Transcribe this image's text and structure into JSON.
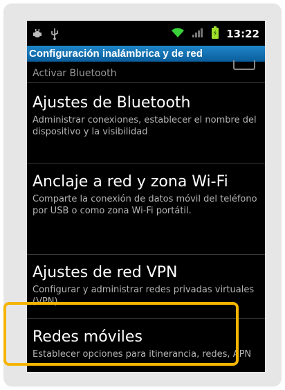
{
  "status_bar": {
    "time": "13:22",
    "icons": [
      "usb-debug-icon",
      "usb-icon",
      "wifi-icon",
      "signal-icon",
      "battery-icon"
    ]
  },
  "title": "Configuración inalámbrica y de red",
  "partial_item": "Activar Bluetooth",
  "items": [
    {
      "title": "Ajustes de Bluetooth",
      "summary": "Administrar conexiones, establecer el nombre del dispositivo y la visibilidad"
    },
    {
      "title": "Anclaje a red y zona Wi-Fi",
      "summary": "Comparte la conexión de datos móvil del teléfono por USB o como zona Wi-Fi portátil."
    },
    {
      "title": "Ajustes de red VPN",
      "summary": "Configurar y administrar redes privadas virtuales (VPN)"
    },
    {
      "title": "Redes móviles",
      "summary": "Establecer opciones para itinerancia, redes, APN"
    }
  ],
  "colors": {
    "title_bar": "#1a78bf",
    "highlight": "#f5b400",
    "background": "#000000"
  }
}
